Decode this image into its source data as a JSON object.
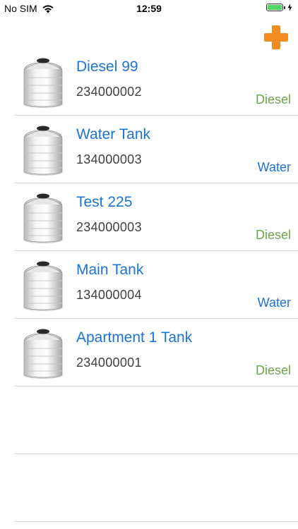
{
  "status_bar": {
    "carrier": "No SIM",
    "time": "12:59",
    "battery_level": 1.0
  },
  "header": {
    "add_icon": "plus-icon",
    "accent_color": "#f28c1e"
  },
  "tanks": [
    {
      "name": "Diesel 99",
      "id": "234000002",
      "type": "Diesel"
    },
    {
      "name": "Water Tank",
      "id": "134000003",
      "type": "Water"
    },
    {
      "name": "Test 225",
      "id": "234000003",
      "type": "Diesel"
    },
    {
      "name": "Main Tank",
      "id": "134000004",
      "type": "Water"
    },
    {
      "name": "Apartment 1 Tank",
      "id": "234000001",
      "type": "Diesel"
    }
  ],
  "colors": {
    "name": "#1a74d8",
    "diesel": "#6ea34c",
    "water": "#1a74d8"
  }
}
